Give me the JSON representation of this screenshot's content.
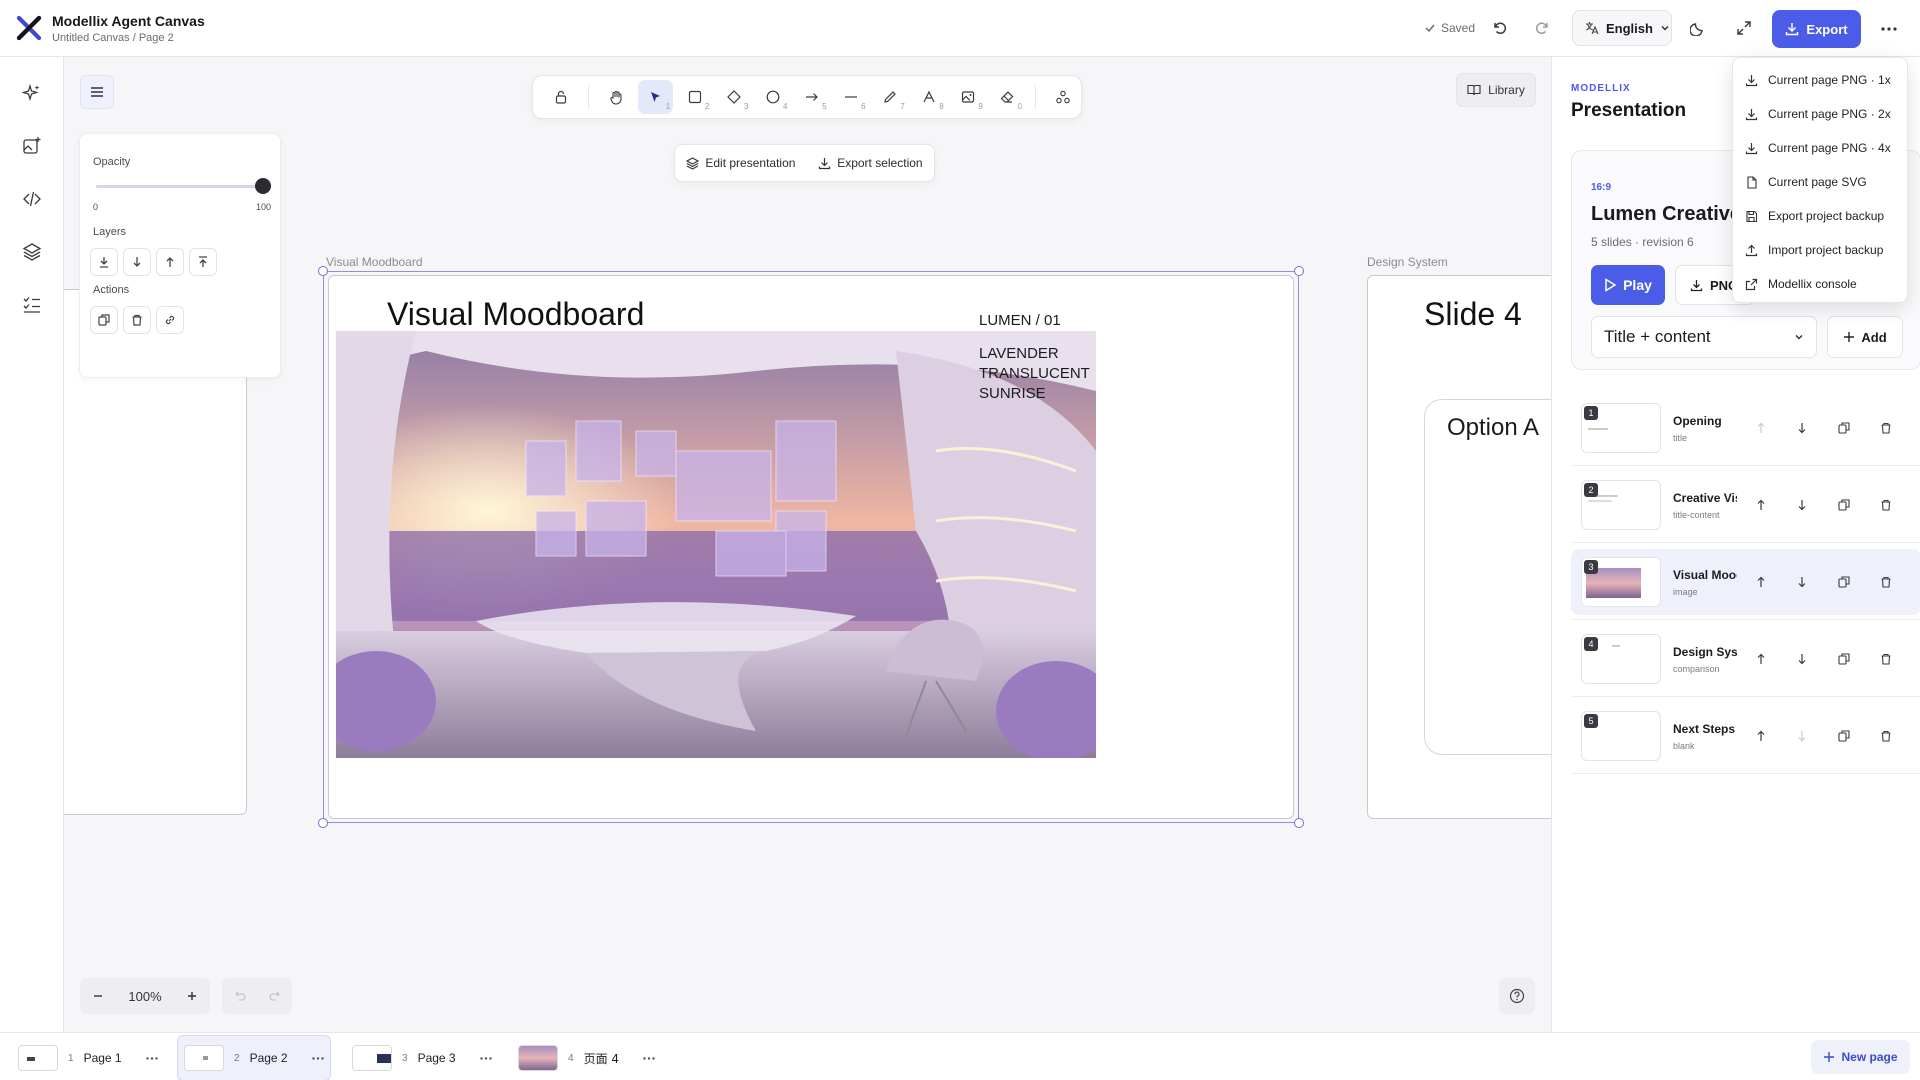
{
  "header": {
    "app_title": "Modellix Agent Canvas",
    "breadcrumb": "Untitled Canvas / Page 2",
    "saved_label": "Saved",
    "language": "English",
    "export_label": "Export",
    "brand_color": "#4a5ce8"
  },
  "canvas": {
    "opacity_label": "Opacity",
    "opacity_min": "0",
    "opacity_max": "100",
    "opacity_value": 100,
    "layers_label": "Layers",
    "actions_label": "Actions",
    "tools": [
      {
        "icon": "lock-icon",
        "key": ""
      },
      {
        "icon": "hand-icon",
        "key": ""
      },
      {
        "icon": "cursor-icon",
        "key": "1"
      },
      {
        "icon": "rectangle-icon",
        "key": "2"
      },
      {
        "icon": "diamond-icon",
        "key": "3"
      },
      {
        "icon": "ellipse-icon",
        "key": "4"
      },
      {
        "icon": "arrow-icon",
        "key": "5"
      },
      {
        "icon": "line-icon",
        "key": "6"
      },
      {
        "icon": "pencil-icon",
        "key": "7"
      },
      {
        "icon": "text-icon",
        "key": "8"
      },
      {
        "icon": "image-icon",
        "key": "9"
      },
      {
        "icon": "eraser-icon",
        "key": "0"
      },
      {
        "icon": "shapes-icon",
        "key": ""
      }
    ],
    "library_label": "Library",
    "edit_presentation_label": "Edit presentation",
    "export_selection_label": "Export selection",
    "frame_label_main": "Visual Moodboard",
    "frame_label_right": "Design System",
    "slide_title": "Visual Moodboard",
    "slide_tag": "LUMEN / 01",
    "slide_words": [
      "LAVENDER",
      "TRANSLUCENT",
      "SUNRISE"
    ],
    "right_slide_title": "Slide 4",
    "right_option": "Option A",
    "zoom_value": "100%"
  },
  "panel": {
    "brand": "MODELLIX",
    "title": "Presentation",
    "aspect": "16:9",
    "deck_title": "Lumen Creative Deck",
    "deck_meta": "5 slides · revision 6",
    "play_label": "Play",
    "png_label": "PNG",
    "layout_value": "Title + content",
    "add_label": "Add",
    "slides": [
      {
        "num": "1",
        "name": "Opening",
        "type": "title"
      },
      {
        "num": "2",
        "name": "Creative Vision",
        "type": "title-content"
      },
      {
        "num": "3",
        "name": "Visual Moodboard",
        "type": "image"
      },
      {
        "num": "4",
        "name": "Design System",
        "type": "comparison"
      },
      {
        "num": "5",
        "name": "Next Steps",
        "type": "blank"
      }
    ]
  },
  "export_menu": {
    "items": [
      {
        "label": "Current page PNG · 1x",
        "icon": "download-icon"
      },
      {
        "label": "Current page PNG · 2x",
        "icon": "download-icon"
      },
      {
        "label": "Current page PNG · 4x",
        "icon": "download-icon"
      },
      {
        "label": "Current page SVG",
        "icon": "file-icon"
      },
      {
        "label": "Export project backup",
        "icon": "save-icon"
      },
      {
        "label": "Import project backup",
        "icon": "upload-icon"
      },
      {
        "label": "Modellix console",
        "icon": "external-link-icon"
      }
    ]
  },
  "pages": {
    "tabs": [
      {
        "num": "1",
        "label": "Page 1"
      },
      {
        "num": "2",
        "label": "Page 2"
      },
      {
        "num": "3",
        "label": "Page 3"
      },
      {
        "num": "4",
        "label": "页面 4"
      }
    ],
    "new_page_label": "New page"
  }
}
